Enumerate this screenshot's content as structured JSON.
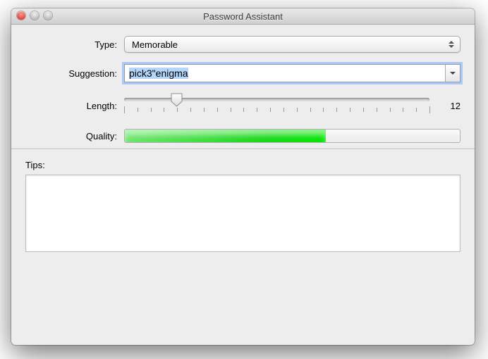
{
  "window": {
    "title": "Password Assistant"
  },
  "labels": {
    "type": "Type:",
    "suggestion": "Suggestion:",
    "length": "Length:",
    "quality": "Quality:",
    "tips": "Tips:"
  },
  "type": {
    "selected": "Memorable"
  },
  "suggestion": {
    "value": "pick3\"enigma"
  },
  "length": {
    "value": 12,
    "min": 8,
    "max": 31,
    "thumb_percent": 17
  },
  "quality": {
    "percent": 60
  },
  "tips": {
    "text": ""
  }
}
